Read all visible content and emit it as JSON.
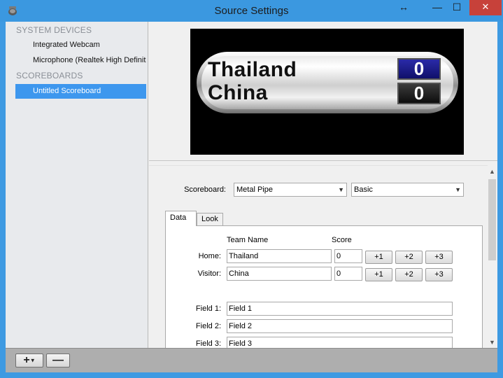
{
  "window": {
    "title": "Source Settings",
    "controls": {
      "resize": "↔",
      "minimize": "—",
      "maximize": "☐",
      "close": "✕"
    }
  },
  "sidebar": {
    "sections": [
      {
        "header": "SYSTEM DEVICES",
        "items": [
          {
            "label": "Integrated Webcam"
          },
          {
            "label": "Microphone (Realtek High Definition Audio)"
          }
        ]
      },
      {
        "header": "SCOREBOARDS",
        "items": [
          {
            "label": "Untitled Scoreboard",
            "selected": true
          }
        ]
      }
    ]
  },
  "bottombar": {
    "add_label": "+",
    "add_caret": "▼",
    "remove_label": "—"
  },
  "preview": {
    "home_team": "Thailand",
    "visitor_team": "China",
    "home_score": "0",
    "visitor_score": "0"
  },
  "settings": {
    "scoreboard_label": "Scoreboard:",
    "scoreboard_value": "Metal Pipe",
    "style_value": "Basic",
    "tabs": [
      {
        "label": "Data",
        "active": true
      },
      {
        "label": "Look",
        "active": false
      }
    ],
    "columns": {
      "team_name": "Team Name",
      "score": "Score"
    },
    "rows": [
      {
        "label": "Home:",
        "team": "Thailand",
        "score": "0",
        "buttons": [
          "+1",
          "+2",
          "+3"
        ]
      },
      {
        "label": "Visitor:",
        "team": "China",
        "score": "0",
        "buttons": [
          "+1",
          "+2",
          "+3"
        ]
      }
    ],
    "fields": [
      {
        "label": "Field 1:",
        "value": "Field 1"
      },
      {
        "label": "Field 2:",
        "value": "Field 2"
      },
      {
        "label": "Field 3:",
        "value": "Field 3"
      }
    ]
  },
  "colors": {
    "titlebar": "#3b98e0",
    "selection": "#3d97ee",
    "close": "#c7413a",
    "home_score_box": "#1d1d8c"
  }
}
